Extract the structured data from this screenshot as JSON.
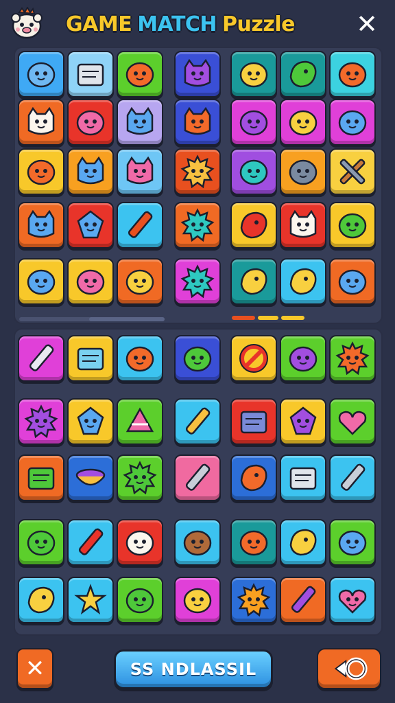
{
  "header": {
    "title_part1": "GAME",
    "title_part2": "MATCH",
    "title_part3": "Puzzle",
    "mascot_icon": "hamster-mascot-icon",
    "close_icon": "close-icon",
    "close_glyph": "✕"
  },
  "colors": {
    "background": "#2b3148",
    "panel": "#363d57",
    "title_yellow": "#f8c82a",
    "title_blue": "#3cc3f0",
    "button_orange": "#f06a24",
    "button_blue": "#2c8fe0"
  },
  "board_top": [
    {
      "row": 0,
      "tiles": [
        {
          "bg": "#3fa9f5",
          "icon": "ghost-icon"
        },
        {
          "bg": "#8fd3f7",
          "icon": "cash-register-icon"
        },
        {
          "bg": "#5ccf2c",
          "icon": "orange-blob-icon"
        },
        {
          "bg": "#3a4fd6",
          "icon": "purple-cat-icon"
        },
        {
          "bg": "#1a9a9a",
          "icon": "yellow-face-icon"
        },
        {
          "bg": "#1a9a9a",
          "icon": "green-bird-icon"
        },
        {
          "bg": "#3cd2e0",
          "icon": "orange-face-icon"
        }
      ]
    },
    {
      "row": 1,
      "tiles": [
        {
          "bg": "#f06a24",
          "icon": "white-cat-icon"
        },
        {
          "bg": "#e8342a",
          "icon": "pink-blob-icon"
        },
        {
          "bg": "#b7a6f0",
          "icon": "blue-cat-icon"
        },
        {
          "bg": "#3a4fd6",
          "icon": "orange-cat-icon"
        },
        {
          "bg": "#e040d8",
          "icon": "purple-bomb-icon"
        },
        {
          "bg": "#e040d8",
          "icon": "yellow-fruit-icon"
        },
        {
          "bg": "#e040d8",
          "icon": "blue-plum-icon"
        }
      ]
    },
    {
      "row": 2,
      "tiles": [
        {
          "bg": "#f8c82a",
          "icon": "speech-bubble-icon"
        },
        {
          "bg": "#f8a020",
          "icon": "blue-cat-icon"
        },
        {
          "bg": "#6ec6f5",
          "icon": "pink-cat-icon"
        },
        {
          "bg": "#e8501f",
          "icon": "sun-lion-icon"
        },
        {
          "bg": "#a04ee0",
          "icon": "teal-turtle-icon"
        },
        {
          "bg": "#f8a020",
          "icon": "gray-stone-icon"
        },
        {
          "bg": "#f8d040",
          "icon": "crossed-tools-icon"
        }
      ]
    },
    {
      "row": 3,
      "tiles": [
        {
          "bg": "#f06a24",
          "icon": "blue-cat-icon"
        },
        {
          "bg": "#e8342a",
          "icon": "blue-gem-icon"
        },
        {
          "bg": "#3cc3f0",
          "icon": "rocket-icon"
        },
        {
          "bg": "#f06a24",
          "icon": "teal-monster-icon"
        },
        {
          "bg": "#f8c82a",
          "icon": "red-bird-icon"
        },
        {
          "bg": "#e8342a",
          "icon": "white-cat-icon"
        },
        {
          "bg": "#f8c82a",
          "icon": "green-frog-icon"
        }
      ]
    },
    {
      "row": 4,
      "tiles": [
        {
          "bg": "#f8c82a",
          "icon": "blue-puffer-icon"
        },
        {
          "bg": "#f8c82a",
          "icon": "pink-blob-icon"
        },
        {
          "bg": "#f06a24",
          "icon": "yellow-face-icon"
        },
        {
          "bg": "#e040d8",
          "icon": "spiky-ball-icon"
        },
        {
          "bg": "#1a9a9a",
          "icon": "lemon-icon"
        },
        {
          "bg": "#3cc3f0",
          "icon": "yellow-lemon-face-icon"
        },
        {
          "bg": "#f06a24",
          "icon": "blue-face-icon"
        }
      ]
    }
  ],
  "board_bottom": [
    {
      "row": 0,
      "tiles": [
        {
          "bg": "#e040d8",
          "icon": "paint-tube-icon"
        },
        {
          "bg": "#f8c82a",
          "icon": "picture-frame-icon"
        },
        {
          "bg": "#3cc3f0",
          "icon": "orange-blob-icon"
        },
        {
          "bg": "#3a4fd6",
          "icon": "green-pin-icon"
        },
        {
          "bg": "#f8c82a",
          "icon": "no-sign-icon"
        },
        {
          "bg": "#5ccf2c",
          "icon": "purple-balloon-icon"
        },
        {
          "bg": "#5ccf2c",
          "icon": "orange-monster-icon"
        }
      ]
    },
    {
      "row": 1,
      "tiles": [
        {
          "bg": "#e040d8",
          "icon": "purple-web-icon"
        },
        {
          "bg": "#f8c82a",
          "icon": "blue-shell-icon"
        },
        {
          "bg": "#5ccf2c",
          "icon": "cake-slice-icon"
        },
        {
          "bg": "#3cc3f0",
          "icon": "rolling-pin-icon"
        },
        {
          "bg": "#e8342a",
          "icon": "paint-bucket-icon"
        },
        {
          "bg": "#f8c82a",
          "icon": "purple-gem-icon"
        },
        {
          "bg": "#5ccf2c",
          "icon": "pink-heart-icon"
        }
      ]
    },
    {
      "row": 2,
      "tiles": [
        {
          "bg": "#f06a24",
          "icon": "green-map-icon"
        },
        {
          "bg": "#2c6ed8",
          "icon": "purple-bowl-icon"
        },
        {
          "bg": "#5ccf2c",
          "icon": "green-monster-icon"
        },
        {
          "bg": "#f06aa0",
          "icon": "tin-bottle-icon"
        },
        {
          "bg": "#2c6ed8",
          "icon": "orange-leaf-icon"
        },
        {
          "bg": "#3cc3f0",
          "icon": "toolbox-icon"
        },
        {
          "bg": "#3cc3f0",
          "icon": "tin-bottle-icon"
        }
      ]
    },
    {
      "row": 3,
      "tiles": [
        {
          "bg": "#5ccf2c",
          "icon": "green-face-icon"
        },
        {
          "bg": "#3cc3f0",
          "icon": "red-crayon-icon"
        },
        {
          "bg": "#e8342a",
          "icon": "white-ghost-icon"
        },
        {
          "bg": "#3cc3f0",
          "icon": "brown-acorn-icon"
        },
        {
          "bg": "#1a9a9a",
          "icon": "orange-onion-icon"
        },
        {
          "bg": "#3cc3f0",
          "icon": "yellow-puzzle-icon"
        },
        {
          "bg": "#5ccf2c",
          "icon": "blue-face-icon"
        }
      ]
    },
    {
      "row": 4,
      "tiles": [
        {
          "bg": "#3cc3f0",
          "icon": "yellow-drop-icon"
        },
        {
          "bg": "#3cc3f0",
          "icon": "yellow-star-icon"
        },
        {
          "bg": "#5ccf2c",
          "icon": "green-fruit-icon"
        },
        {
          "bg": "#e040d8",
          "icon": "yellow-flower-icon"
        },
        {
          "bg": "#2c6ed8",
          "icon": "sunflower-icon"
        },
        {
          "bg": "#f06a24",
          "icon": "purple-crayon-icon"
        },
        {
          "bg": "#3cc3f0",
          "icon": "pink-heart-face-icon"
        }
      ]
    }
  ],
  "footer": {
    "close_glyph": "✕",
    "main_button_label": "SS NDLASSIL",
    "undo_icon": "undo-icon"
  }
}
